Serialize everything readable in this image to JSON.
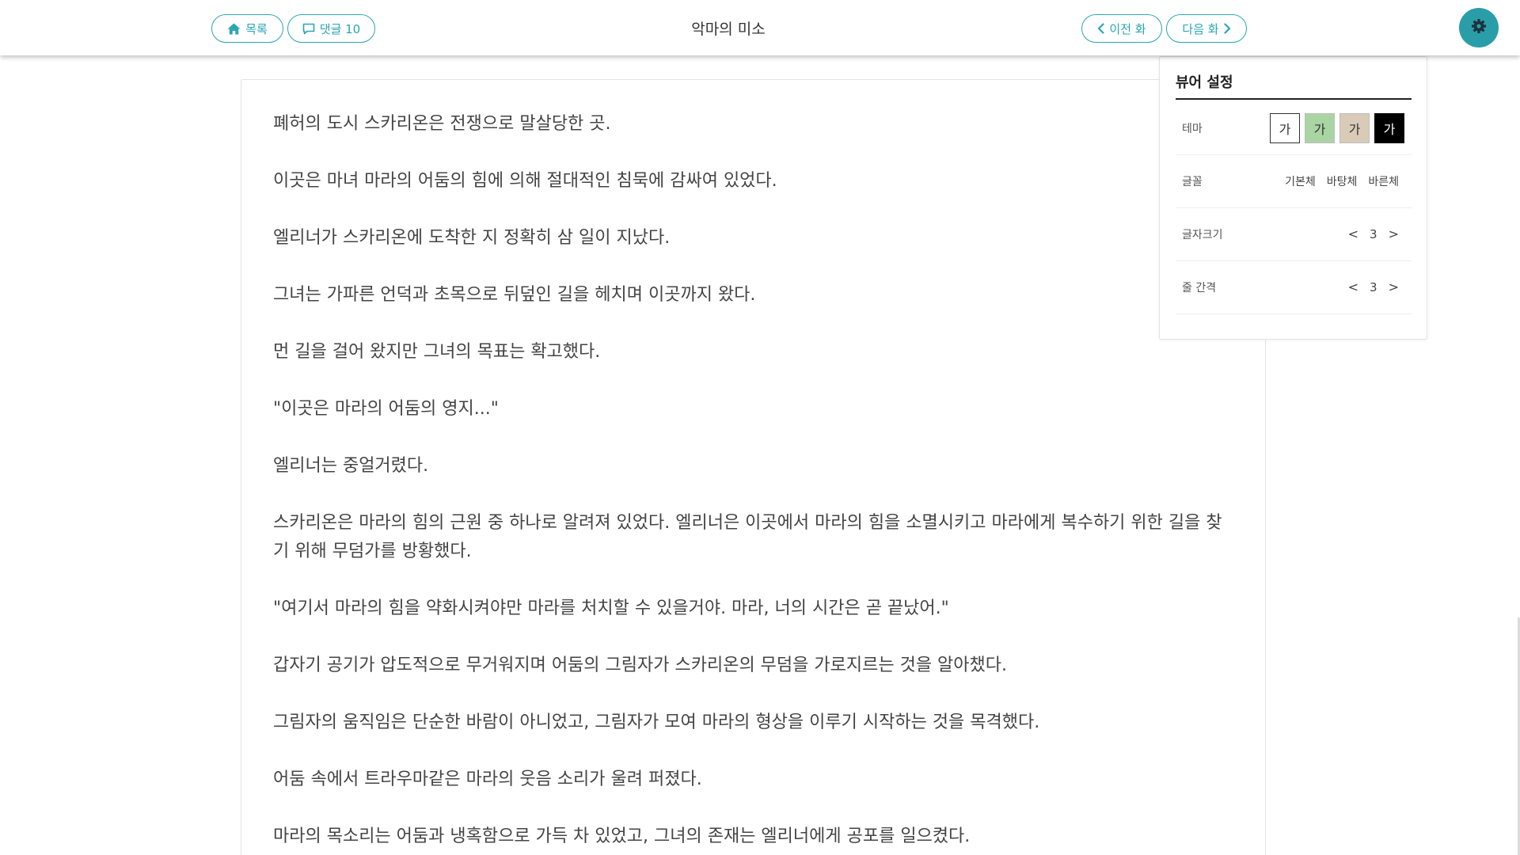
{
  "header": {
    "list_label": "목록",
    "comments_label": "댓글 10",
    "title": "악마의 미소",
    "prev_label": "이전 화",
    "next_label": "다음 화"
  },
  "colors": {
    "accent": "#2aa6b2",
    "gear_bg": "#2a9ea8"
  },
  "icons": {
    "list": "home-icon",
    "comments": "comment-icon",
    "prev": "chevron-left-icon",
    "next": "chevron-right-icon",
    "settings": "gear-icon"
  },
  "content": {
    "paragraphs": [
      "폐허의 도시 스카리온은 전쟁으로 말살당한 곳.",
      "이곳은 마녀 마라의 어둠의 힘에 의해 절대적인 침묵에 감싸여 있었다.",
      "엘리너가 스카리온에 도착한 지 정확히 삼 일이 지났다.",
      "그녀는 가파른 언덕과 초목으로 뒤덮인 길을 헤치며 이곳까지 왔다.",
      "먼 길을 걸어 왔지만 그녀의 목표는 확고했다.",
      "\"이곳은 마라의 어둠의 영지...\"",
      "엘리너는 중얼거렸다.",
      "스카리온은 마라의 힘의 근원 중 하나로 알려져 있었다. 엘리너은 이곳에서 마라의 힘을 소멸시키고 마라에게 복수하기 위한 길을 찾기 위해 무덤가를 방황했다.",
      "\"여기서 마라의 힘을 약화시켜야만 마라를 처치할 수 있을거야. 마라, 너의 시간은 곧 끝났어.\"",
      "갑자기 공기가 압도적으로 무거워지며 어둠의 그림자가 스카리온의 무덤을 가로지르는 것을 알아챘다.",
      "그림자의 움직임은 단순한 바람이 아니었고, 그림자가 모여 마라의 형상을 이루기 시작하는 것을 목격했다.",
      "어둠 속에서 트라우마같은 마라의 웃음 소리가 울려 퍼졌다.",
      "마라의 목소리는 어둠과 냉혹함으로 가득 차 있었고, 그녀의 존재는 엘리너에게 공포를 일으켰다."
    ]
  },
  "settings": {
    "title": "뷰어 설정",
    "theme": {
      "label": "테마",
      "swatches": [
        {
          "glyph": "가",
          "bg": "#ffffff",
          "fg": "#333333",
          "border": "#333333"
        },
        {
          "glyph": "가",
          "bg": "#a9d5a2",
          "fg": "#333333",
          "border": "#bdbdbd"
        },
        {
          "glyph": "가",
          "bg": "#d9cbb8",
          "fg": "#333333",
          "border": "#bdbdbd"
        },
        {
          "glyph": "가",
          "bg": "#000000",
          "fg": "#ffffff",
          "border": "#000000"
        }
      ]
    },
    "font": {
      "label": "글꼴",
      "options": [
        "기본체",
        "바탕체",
        "바른체"
      ]
    },
    "font_size": {
      "label": "글자크기",
      "prev": "<",
      "value": "3",
      "next": ">"
    },
    "line_spacing": {
      "label": "줄 간격",
      "prev": "<",
      "value": "3",
      "next": ">"
    }
  }
}
